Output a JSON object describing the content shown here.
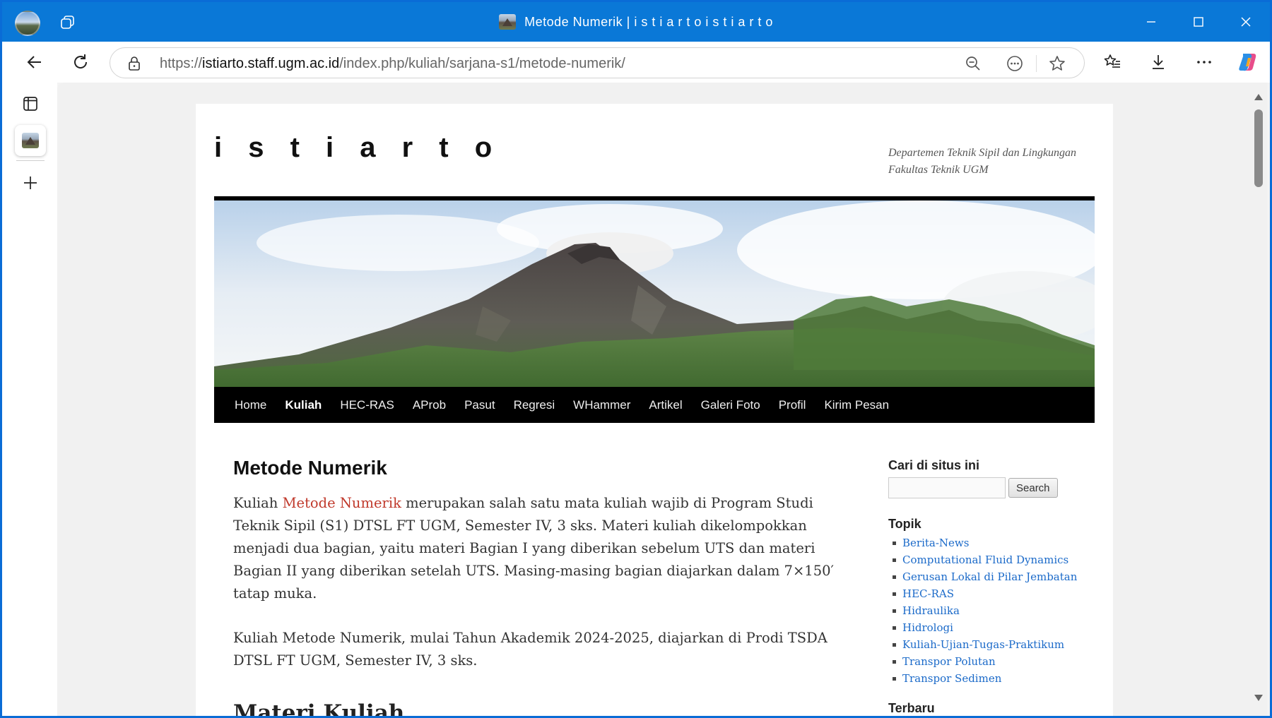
{
  "browser": {
    "tab_title": "Metode Numerik | i s t i a r t o i s t i a r t o",
    "url_prefix": "https://",
    "url_domain": "istiarto.staff.ugm.ac.id",
    "url_path": "/index.php/kuliah/sarjana-s1/metode-numerik/"
  },
  "site": {
    "title": "i s t i a r t o",
    "description": "Departemen Teknik Sipil dan Lingkungan Fakultas Teknik UGM"
  },
  "nav": [
    "Home",
    "Kuliah",
    "HEC-RAS",
    "AProb",
    "Pasut",
    "Regresi",
    "WHammer",
    "Artikel",
    "Galeri Foto",
    "Profil",
    "Kirim Pesan"
  ],
  "content": {
    "title": "Metode Numerik",
    "p1_pre": "Kuliah ",
    "p1_link": "Metode Numerik",
    "p1_post": " merupakan salah satu mata kuliah wajib di Program Studi Teknik Sipil (S1) DTSL FT UGM, Semester IV, 3 sks. Materi kuliah dikelompokkan menjadi dua bagian, yaitu materi Bagian I yang diberikan sebelum UTS dan materi Bagian II yang diberikan setelah UTS. Masing-masing bagian diajarkan dalam 7×150′ tatap muka.",
    "p2": "Kuliah Metode Numerik, mulai Tahun Akademik 2024-2025, diajarkan di Prodi TSDA DTSL FT UGM, Semester IV, 3 sks.",
    "h2": "Materi Kuliah"
  },
  "sidebar": {
    "search_title": "Cari di situs ini",
    "search_button": "Search",
    "search_value": "",
    "topik_title": "Topik",
    "topik": [
      "Berita-News",
      "Computational Fluid Dynamics",
      "Gerusan Lokal di Pilar Jembatan",
      "HEC-RAS",
      "Hidraulika",
      "Hidrologi",
      "Kuliah-Ujian-Tugas-Praktikum",
      "Transpor Polutan",
      "Transpor Sedimen"
    ],
    "terbaru_title": "Terbaru"
  },
  "colors": {
    "titlebar": "#0a78d7",
    "link": "#1b6ac9",
    "content_link": "#c0392b",
    "nav_bg": "#000000"
  },
  "icons": [
    "profile-avatar-icon",
    "tab-actions-icon",
    "back-arrow-icon",
    "refresh-icon",
    "lock-icon",
    "zoom-out-icon",
    "read-aloud-icon",
    "favorite-star-icon",
    "favorites-list-icon",
    "download-icon",
    "more-icon",
    "copilot-icon",
    "sidebar-toggle-icon",
    "new-tab-plus-icon"
  ]
}
